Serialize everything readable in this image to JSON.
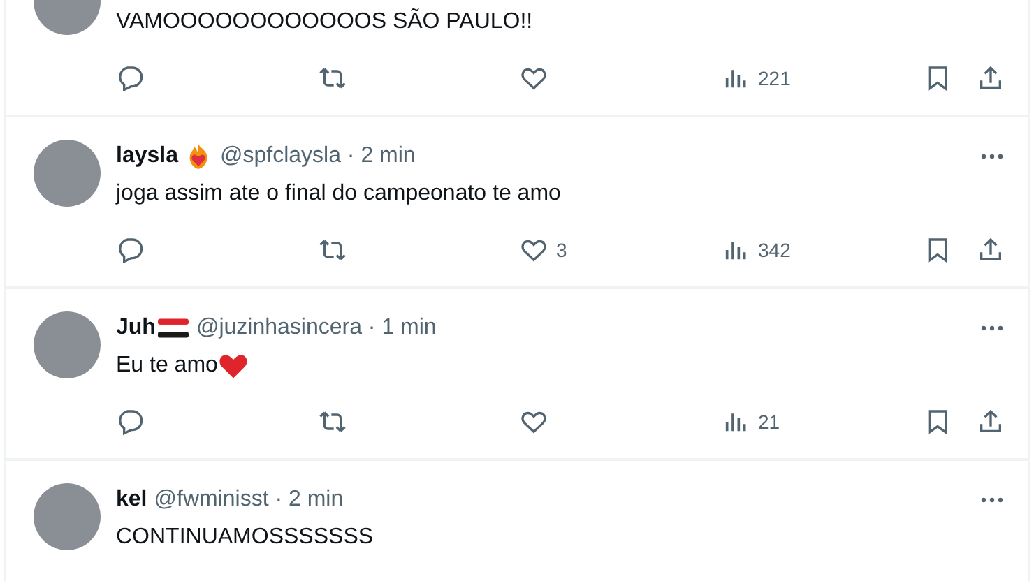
{
  "posts": [
    {
      "text": "VAMOOOOOOOOOOOOS SÃO PAULO!!",
      "views": "221"
    },
    {
      "name": "laysla",
      "badge": {
        "kind": "fire-heart"
      },
      "meta": "@spfclaysla · 2 min",
      "text": "joga assim ate o final do campeonato te amo",
      "likes": "3",
      "views": "342"
    },
    {
      "name": "Juh",
      "badge": {
        "kind": "flag"
      },
      "meta": "@juzinhasincera · 1 min",
      "text": "Eu te amo",
      "text_icon": {
        "kind": "heart"
      },
      "views": "21"
    },
    {
      "name": "kel",
      "meta": "@fwminisst · 2 min",
      "text": "CONTINUAMOSSSSSSS"
    }
  ]
}
